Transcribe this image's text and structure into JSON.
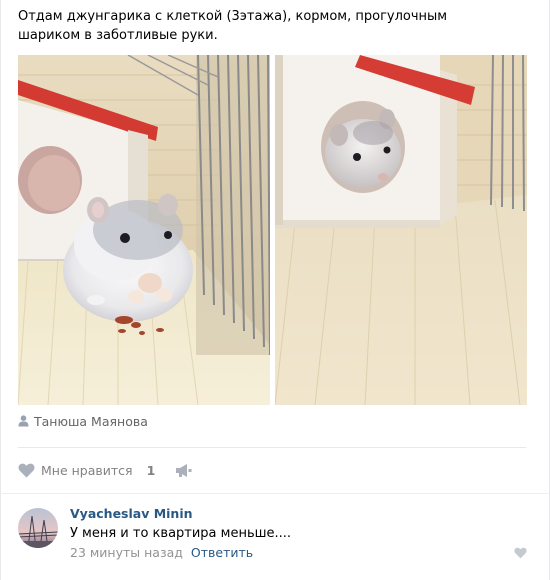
{
  "post": {
    "text": "Отдам джунгарика с клеткой (3этажа), кормом, прогулочным шариком в заботливые руки.",
    "author": "Танюша Маянова",
    "photos": [
      {
        "icon": "hamster-photo"
      },
      {
        "icon": "hamster-in-house-photo"
      }
    ]
  },
  "actions": {
    "like_label": "Мне нравится",
    "like_count": "1",
    "icons": [
      "heart-icon",
      "share-icon"
    ]
  },
  "comment": {
    "author": "Vyacheslav Minin",
    "text": "У меня и то квартира меньше....",
    "time": "23 минуты назад",
    "reply_label": "Ответить"
  },
  "colors": {
    "link": "#2a5885",
    "secondary_text": "#828282",
    "background": "#edeef0"
  }
}
